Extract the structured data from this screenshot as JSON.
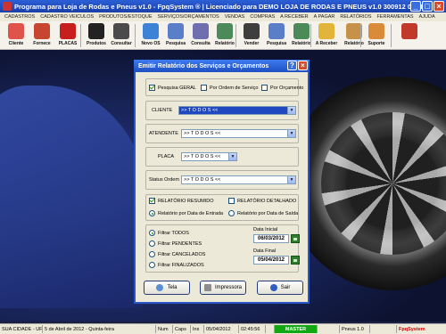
{
  "app": {
    "title": "Programa para Loja de Rodas e Pneus v1.0 - FpqSystem ® | Licenciado para DEMO LOJA DE RODAS E PNEUS v1.0 300912 010412",
    "window_controls": {
      "minimize": "_",
      "maximize": "□",
      "close": "×"
    }
  },
  "menu": [
    "CADASTROS",
    "CADASTRO VEICULOS",
    "PRODUTOS/ESTOQUE",
    "SERVIÇOS/ORÇAMENTOS",
    "VENDAS",
    "COMPRAS",
    "A RECEBER",
    "A PAGAR",
    "RELATÓRIOS",
    "FERRAMENTAS",
    "AJUDA"
  ],
  "toolbar": [
    {
      "label": "Cliente",
      "icon": "client-icon",
      "color": "#e0534a"
    },
    {
      "label": "Fornece",
      "icon": "supplier-icon",
      "color": "#c7462f"
    },
    {
      "label": "PLACAS",
      "icon": "plate-icon",
      "color": "#c81e1e"
    },
    {
      "label": "Produtos",
      "icon": "tire-icon",
      "color": "#222222"
    },
    {
      "label": "Consultar",
      "icon": "consult-icon",
      "color": "#4b4b4b"
    },
    {
      "label": "Novo OS",
      "icon": "new-os-icon",
      "color": "#3c82d6"
    },
    {
      "label": "Pesquisa",
      "icon": "search-os-icon",
      "color": "#5a7fc8"
    },
    {
      "label": "Consulta",
      "icon": "consult-os-icon",
      "color": "#6f6fb0"
    },
    {
      "label": "Relatório",
      "icon": "report-icon",
      "color": "#4d8a5a"
    },
    {
      "label": "Vender",
      "icon": "sell-icon",
      "color": "#3e3e3e"
    },
    {
      "label": "Pesquisa",
      "icon": "search-sale-icon",
      "color": "#5a7fc8"
    },
    {
      "label": "Relatório",
      "icon": "sale-report-icon",
      "color": "#4d8a5a"
    },
    {
      "label": "A Receber",
      "icon": "receivable-icon",
      "color": "#e2b43a"
    },
    {
      "label": "Relatório",
      "icon": "finance-report-icon",
      "color": "#c6924a"
    },
    {
      "label": "Suporte",
      "icon": "support-icon",
      "color": "#d98b3a"
    },
    {
      "label": "",
      "icon": "exit-icon",
      "color": "#c0392b"
    }
  ],
  "dialog": {
    "title": "Emitir Relatório dos Serviços e Orçamentos",
    "help": "?",
    "close": "×",
    "search_modes": [
      {
        "label": "Pesquisa GERAL",
        "checked": true
      },
      {
        "label": "Por Ordem de Serviço",
        "checked": false
      },
      {
        "label": "Por Orçamento",
        "checked": false
      }
    ],
    "cliente": {
      "label": "CLIENTE",
      "value": ">> T O D O S <<"
    },
    "atendente": {
      "label": "ATENDENTE",
      "value": ">> T O D O S <<"
    },
    "placa": {
      "label": "PLACA",
      "value": ">> T O D O S <<"
    },
    "status_ordem": {
      "label": "Status Ordem",
      "value": ">> T O D O S <<"
    },
    "report_types": [
      {
        "label": "RELATÓRIO RESUMIDO",
        "checked": true
      },
      {
        "label": "RELATÓRIO DETALHADO",
        "checked": false
      }
    ],
    "date_basis": [
      {
        "label": "Relatório por Data de Entrada",
        "checked": true
      },
      {
        "label": "Relatório por Data de Saída",
        "checked": false
      }
    ],
    "filters": [
      {
        "label": "Filtrar TODOS",
        "checked": true
      },
      {
        "label": "Filtrar PENDENTES",
        "checked": false
      },
      {
        "label": "Filtrar CANCELADOS",
        "checked": false
      },
      {
        "label": "Filtrar FINALIZADOS",
        "checked": false
      }
    ],
    "data_inicial": {
      "label": "Data Inicial",
      "value": "06/03/2012"
    },
    "data_final": {
      "label": "Data Final",
      "value": "05/04/2012"
    },
    "buttons": {
      "tela": "Tela",
      "impressora": "Impressora",
      "sair": "Sair"
    }
  },
  "status": {
    "city": "SUA CIDADE - UF",
    "date_text": "5 de Abril de 2012 - Quinta-feira",
    "num": "Num",
    "caps": "Caps",
    "ins": "Ins",
    "date": "05/04/2012",
    "time": "02:45:56",
    "master": "MASTER",
    "version": "Pneus 1.0",
    "brand": "FpqSystem"
  },
  "colors": {
    "titlebar": "#1f4fc4",
    "dialog_border": "#2a56c6",
    "accent_green": "#21a121",
    "status_master": "#13a813"
  }
}
